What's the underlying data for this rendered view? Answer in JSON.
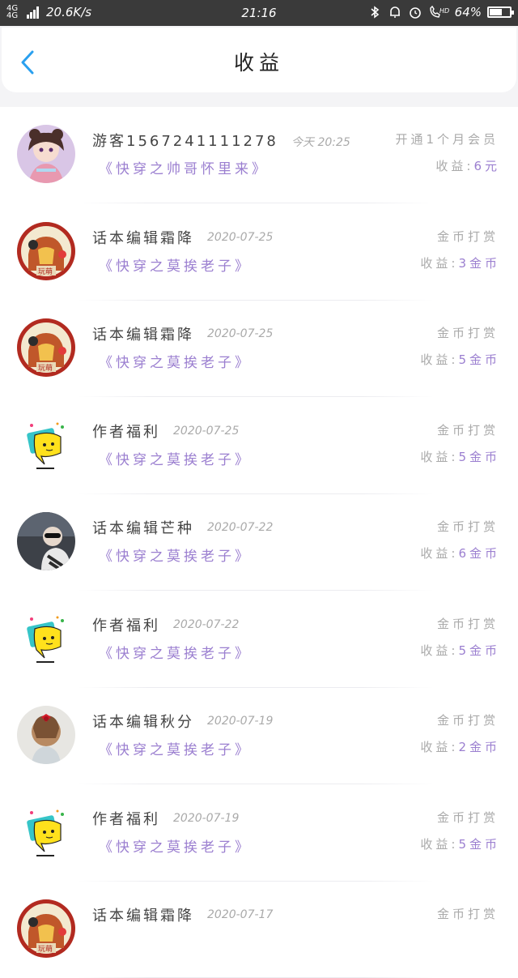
{
  "status_bar": {
    "network": "4G 4G",
    "speed": "20.6K/s",
    "time": "21:16",
    "battery": "64%",
    "battery_level": 0.64,
    "icons": [
      "bluetooth-icon",
      "bell-icon",
      "alarm-icon",
      "hd-call-icon",
      "battery-icon"
    ]
  },
  "header": {
    "title": "收益",
    "back_icon": "chevron-left-icon"
  },
  "colors": {
    "accent": "#9b7fd0",
    "back": "#2aa0ef",
    "muted": "#aaaaaa"
  },
  "income_list": [
    {
      "name": "游客1567241111278",
      "date": "今天 20:25",
      "book": "《快穿之帅哥怀里来》",
      "type": "开通1个月会员",
      "income_label": "收益:",
      "amount": "6元",
      "avatar": "anime-girl-avatar"
    },
    {
      "name": "话本编辑霜降",
      "date": "2020-07-25",
      "book": "《快穿之莫挨老子》",
      "type": "金币打赏",
      "income_label": "收益:",
      "amount": "3金币",
      "avatar": "cartoon-avatar"
    },
    {
      "name": "话本编辑霜降",
      "date": "2020-07-25",
      "book": "《快穿之莫挨老子》",
      "type": "金币打赏",
      "income_label": "收益:",
      "amount": "5金币",
      "avatar": "cartoon-avatar"
    },
    {
      "name": "作者福利",
      "date": "2020-07-25",
      "book": "《快穿之莫挨老子》",
      "type": "金币打赏",
      "income_label": "收益:",
      "amount": "5金币",
      "avatar": "chat-bubble-avatar"
    },
    {
      "name": "话本编辑芒种",
      "date": "2020-07-22",
      "book": "《快穿之莫挨老子》",
      "type": "金币打赏",
      "income_label": "收益:",
      "amount": "6金币",
      "avatar": "photo-avatar"
    },
    {
      "name": "作者福利",
      "date": "2020-07-22",
      "book": "《快穿之莫挨老子》",
      "type": "金币打赏",
      "income_label": "收益:",
      "amount": "5金币",
      "avatar": "chat-bubble-avatar"
    },
    {
      "name": "话本编辑秋分",
      "date": "2020-07-19",
      "book": "《快穿之莫挨老子》",
      "type": "金币打赏",
      "income_label": "收益:",
      "amount": "2金币",
      "avatar": "girl-photo-avatar"
    },
    {
      "name": "作者福利",
      "date": "2020-07-19",
      "book": "《快穿之莫挨老子》",
      "type": "金币打赏",
      "income_label": "收益:",
      "amount": "5金币",
      "avatar": "chat-bubble-avatar"
    },
    {
      "name": "话本编辑霜降",
      "date": "2020-07-17",
      "book": "",
      "type": "金币打赏",
      "income_label": "",
      "amount": "",
      "avatar": "cartoon-avatar"
    }
  ]
}
